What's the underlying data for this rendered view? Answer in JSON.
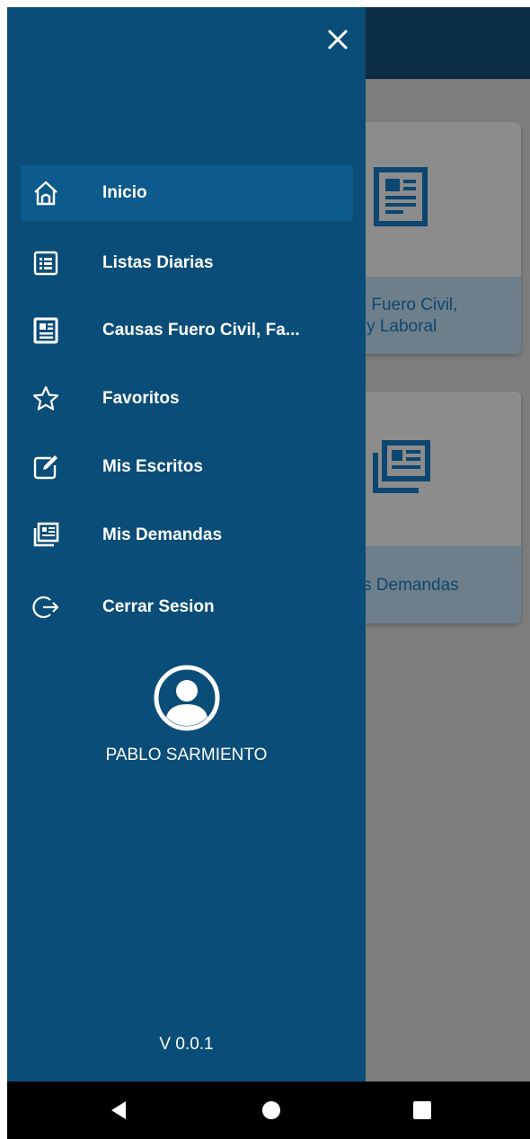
{
  "background": {
    "cards": [
      {
        "label_line1": "as Fuero Civil,",
        "label_line2": "ia y Laboral",
        "icon": "newspaper-icon"
      },
      {
        "label_line1": "s Demandas",
        "icon": "newspapers-icon"
      }
    ]
  },
  "drawer": {
    "close_icon": "close-icon",
    "items": [
      {
        "label": "Inicio",
        "icon": "home-icon",
        "active": true
      },
      {
        "label": "Listas Diarias",
        "icon": "list-icon"
      },
      {
        "label": "Causas Fuero Civil, Fa...",
        "icon": "document-icon"
      },
      {
        "label": "Favoritos",
        "icon": "star-icon"
      },
      {
        "label": "Mis Escritos",
        "icon": "edit-icon"
      },
      {
        "label": "Mis Demandas",
        "icon": "newspapers-icon"
      },
      {
        "label": "Cerrar Sesion",
        "icon": "logout-icon"
      }
    ],
    "user": {
      "name": "PABLO SARMIENTO",
      "avatar_icon": "avatar-icon"
    },
    "version": "V 0.0.1"
  },
  "navbar": {
    "back_icon": "back-icon",
    "home_icon": "home-circle-icon",
    "recents_icon": "recents-icon"
  },
  "colors": {
    "drawer_bg": "#0a4d78",
    "active_item_bg": "#0d5a8c",
    "topbar_bg": "#0b2e45",
    "navbar_bg": "#000000"
  }
}
